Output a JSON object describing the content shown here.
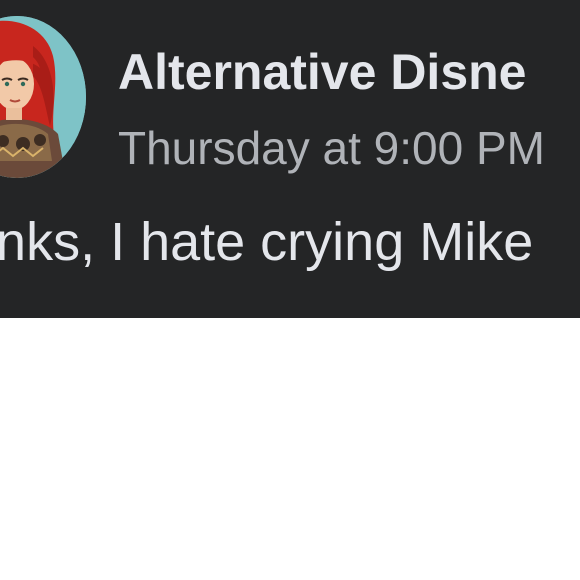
{
  "post": {
    "page_name": "Alternative Disne",
    "timestamp": "Thursday at 9:00 PM",
    "text": "anks, I hate crying Mike",
    "avatar_icon": "profile-avatar-icon"
  },
  "colors": {
    "header_background": "#242526",
    "name_text": "#e4e6eb",
    "timestamp_text": "#b0b3b8",
    "avatar_background": "#7ec3c7",
    "hair": "#c8261e",
    "page_background": "#ffffff"
  }
}
